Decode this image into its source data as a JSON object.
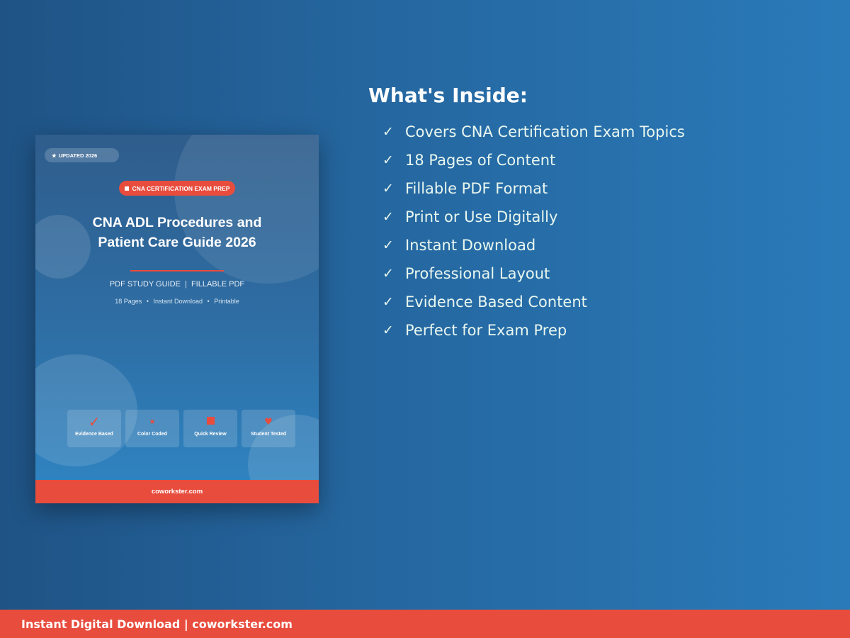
{
  "cover": {
    "updated_badge": {
      "icon": "star-icon",
      "icon_glyph": "★",
      "label": "UPDATED 2026"
    },
    "exam_badge": "CNA CERTIFICATION EXAM PREP",
    "title_lines": [
      "CNA ADL Procedures and",
      "Patient Care Guide 2026"
    ],
    "formats": "PDF STUDY GUIDE  |  FILLABLE PDF",
    "meta": [
      "18 Pages",
      "Instant Download",
      "Printable"
    ],
    "meta_separator": "•",
    "features": [
      {
        "icon": "check-icon",
        "glyph": "✓",
        "label": "Evidence Based"
      },
      {
        "icon": "star-icon",
        "glyph": "★",
        "label": "Color Coded"
      },
      {
        "icon": "square-icon",
        "glyph": "",
        "label": "Quick Review"
      },
      {
        "icon": "heart-icon",
        "glyph": "♥",
        "label": "Student Tested"
      }
    ],
    "footer_url": "coworkster.com"
  },
  "inside": {
    "heading": "What's Inside:",
    "check_glyph": "✓",
    "items": [
      "Covers CNA Certification Exam Topics",
      "18 Pages of Content",
      "Fillable PDF Format",
      "Print or Use Digitally",
      "Instant Download",
      "Professional Layout",
      "Evidence Based Content",
      "Perfect for Exam Prep"
    ]
  },
  "footer": {
    "text": "Instant Digital Download | coworkster.com"
  },
  "colors": {
    "accent": "#e84c3d",
    "background_left": "#1f5385",
    "background_right": "#2a7ab9",
    "list_text": "#e9f7ef"
  }
}
